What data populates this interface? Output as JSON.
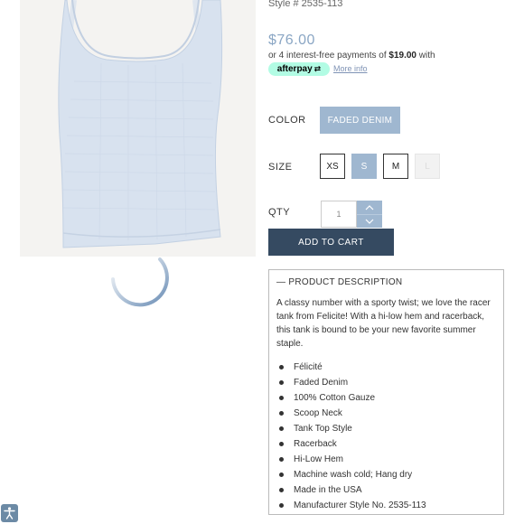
{
  "product": {
    "style_line": "Style # 2535-113",
    "price": "$76.00",
    "installments_prefix": "or 4 interest-free payments of ",
    "installments_amount": "$19.00",
    "installments_suffix": " with",
    "afterpay_label": "afterpay",
    "more_info_label": "More info"
  },
  "options": {
    "color_label": "COLOR",
    "color_value": "FADED DENIM",
    "size_label": "SIZE",
    "sizes": [
      {
        "label": "XS",
        "state": "available"
      },
      {
        "label": "S",
        "state": "selected"
      },
      {
        "label": "M",
        "state": "available"
      },
      {
        "label": "L",
        "state": "sold-out"
      }
    ],
    "qty_label": "QTY",
    "qty_value": "1"
  },
  "cart": {
    "add_label": "ADD TO CART"
  },
  "description": {
    "title": "— PRODUCT DESCRIPTION",
    "body": "A classy number with a sporty twist; we love the racer tank from Felicite! With a hi-low hem and racerback, this tank is bound to be your new favorite summer staple.",
    "features": [
      "Félicité",
      "Faded Denim",
      "100% Cotton Gauze",
      "Scoop Neck",
      "Tank Top Style",
      "Racerback",
      "Hi-Low Hem",
      "Machine wash cold; Hang dry",
      "Made in the USA",
      "Manufacturer Style No. 2535-113"
    ]
  },
  "icons": {
    "stepper_up": "chevron-up-icon",
    "stepper_down": "chevron-down-icon",
    "afterpay": "afterpay-arrows-icon",
    "accessibility": "accessibility-icon",
    "loading": "loading-spinner-icon"
  },
  "colors": {
    "accent": "#9fb7d0",
    "button_dark": "#354a61",
    "price": "#8aa6c4",
    "afterpay_mint": "#b2fce4"
  }
}
